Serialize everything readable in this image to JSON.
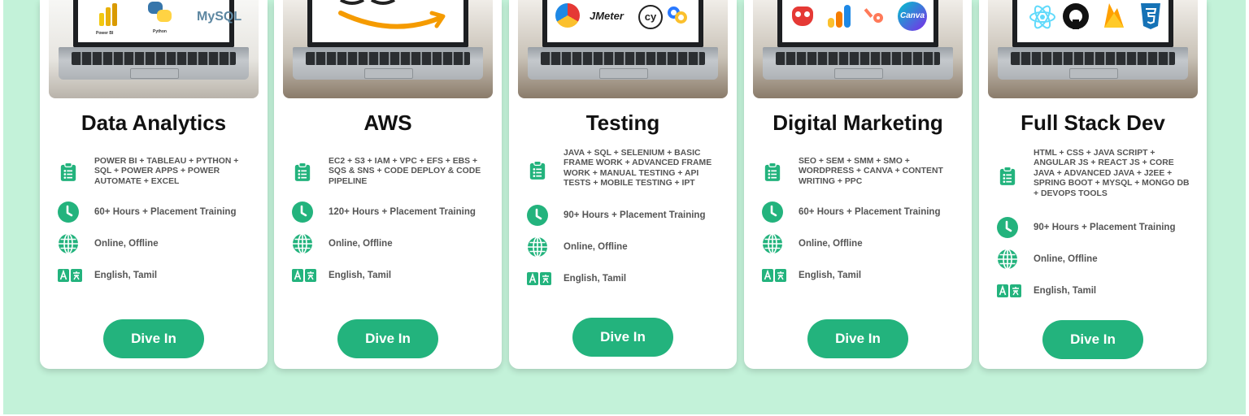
{
  "theme": {
    "accent": "#23b37d",
    "background": "#c3f2d9",
    "card": "#ffffff",
    "title_color": "#111111",
    "text_color": "#555555"
  },
  "cards": [
    {
      "title": "Data Analytics",
      "thumbnail_logos": [
        "Power BI",
        "Python",
        "MySQL"
      ],
      "curriculum": "POWER BI + TABLEAU + PYTHON + SQL + POWER APPS + POWER AUTOMATE + EXCEL",
      "duration": "60+ Hours + Placement Training",
      "mode": "Online, Offline",
      "languages": "English, Tamil",
      "button_label": "Dive In"
    },
    {
      "title": "AWS",
      "thumbnail_logos": [
        "amazon-smile-logo"
      ],
      "curriculum": "EC2 + S3 + IAM + VPC + EFS + EBS + SQS & SNS + CODE DEPLOY & CODE PIPELINE",
      "duration": "120+ Hours + Placement Training",
      "mode": "Online, Offline",
      "languages": "English, Tamil",
      "button_label": "Dive In"
    },
    {
      "title": "Testing",
      "thumbnail_logos": [
        "JMeter",
        "cy"
      ],
      "curriculum": "JAVA + SQL + SELENIUM + BASIC FRAME WORK + ADVANCED FRAME WORK + MANUAL TESTING + API TESTS + MOBILE TESTING + IPT",
      "duration": "90+ Hours + Placement Training",
      "mode": "Online, Offline",
      "languages": "English, Tamil",
      "button_label": "Dive In"
    },
    {
      "title": "Digital Marketing",
      "thumbnail_logos": [
        "Canva"
      ],
      "curriculum": "SEO + SEM + SMM + SMO + WORDPRESS + CANVA + CONTENT WRITING + PPC",
      "duration": "60+ Hours + Placement Training",
      "mode": "Online, Offline",
      "languages": "English, Tamil",
      "button_label": "Dive In"
    },
    {
      "title": "Full Stack Dev",
      "thumbnail_logos": [
        "react-logo",
        "github-logo",
        "firebase-logo",
        "css3-logo"
      ],
      "curriculum": "HTML + CSS + JAVA SCRIPT + ANGULAR JS + REACT JS + CORE JAVA + ADVANCED JAVA + J2EE + SPRING BOOT + MYSQL + MONGO DB + DEVOPS TOOLS",
      "duration": "90+ Hours + Placement Training",
      "mode": "Online, Offline",
      "languages": "English, Tamil",
      "button_label": "Dive In"
    }
  ],
  "icons": {
    "curriculum": "clipboard-list-icon",
    "duration": "clock-icon",
    "mode": "globe-icon",
    "languages": "translate-icon"
  }
}
